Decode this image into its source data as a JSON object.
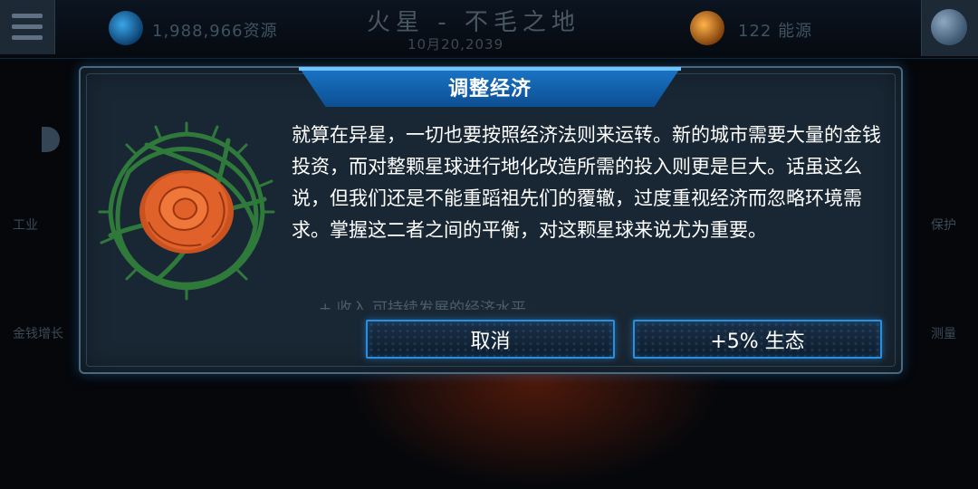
{
  "hud": {
    "resources": "1,988,966资源",
    "planet_title": "火星 - 不毛之地",
    "date": "10月20,2039",
    "energy": "122 能源",
    "left_labels": [
      "工业",
      "金钱增长"
    ],
    "right_labels": [
      "保护",
      "测量"
    ]
  },
  "dialog": {
    "title": "调整经济",
    "body": "就算在异星，一切也要按照经济法则来运转。新的城市需要大量的金钱投资，而对整颗星球进行地化改造所需的投入则更是巨大。话虽这么说，但我们还是不能重蹈祖先们的覆辙，过度重视经济而忽略环境需求。掌握这二者之间的平衡，对这颗星球来说尤为重要。",
    "faded_line": "+ 收入   可持续发展的经济水平",
    "cancel_label": "取消",
    "eco_label": "+5% 生态"
  },
  "colors": {
    "accent": "#2b8fe0",
    "title_tab": "#1b76c7",
    "rose": "#e0622a",
    "thorns": "#2f7a3a"
  }
}
